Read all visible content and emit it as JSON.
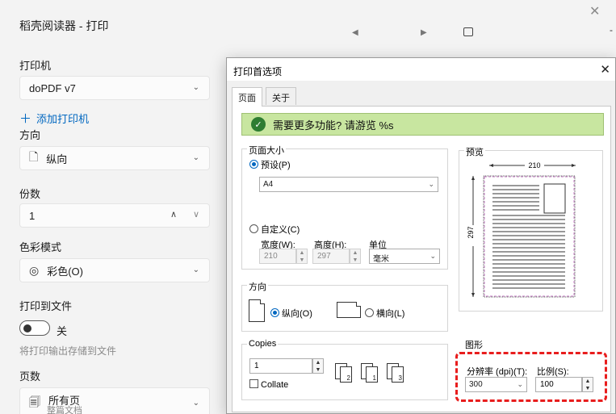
{
  "background": {
    "title": "稻壳阅读器 - 打印",
    "printer_label": "打印机",
    "printer_value": "doPDF v7",
    "add_printer": "添加打印机",
    "orientation_label": "方向",
    "orientation_value": "纵向",
    "copies_label": "份数",
    "copies_value": "1",
    "color_label": "色彩模式",
    "color_value": "彩色(O)",
    "print_to_file_label": "打印到文件",
    "toggle_state": "关",
    "print_to_file_hint": "将打印输出存储到文件",
    "pages_label": "页数",
    "pages_value": "所有页",
    "pages_sub": "整篇文档",
    "right_edge_char": "-"
  },
  "dialog": {
    "title": "打印首选项",
    "tabs": [
      "页面",
      "关于"
    ],
    "banner_text": "需要更多功能? 请游览 %s",
    "page_size": {
      "group_title": "页面大小",
      "preset_label": "预设(P)",
      "preset_value": "A4",
      "custom_label": "自定义(C)",
      "width_label": "宽度(W):",
      "height_label": "高度(H):",
      "unit_label": "单位",
      "width_value": "210",
      "height_value": "297",
      "unit_value": "毫米"
    },
    "orientation": {
      "group_title": "方向",
      "portrait": "纵向(O)",
      "landscape": "横向(L)"
    },
    "copies": {
      "group_title": "Copies",
      "value": "1",
      "collate": "Collate",
      "page_numbers": [
        "1",
        "2",
        "3",
        "1",
        "2",
        "3"
      ]
    },
    "preview": {
      "group_title": "预览",
      "width_dim": "210",
      "height_dim": "297"
    },
    "graphics": {
      "group_title": "图形",
      "resolution_label": "分辨率 (dpi)(T):",
      "resolution_value": "300",
      "scale_label": "比例(S):",
      "scale_value": "100"
    }
  }
}
